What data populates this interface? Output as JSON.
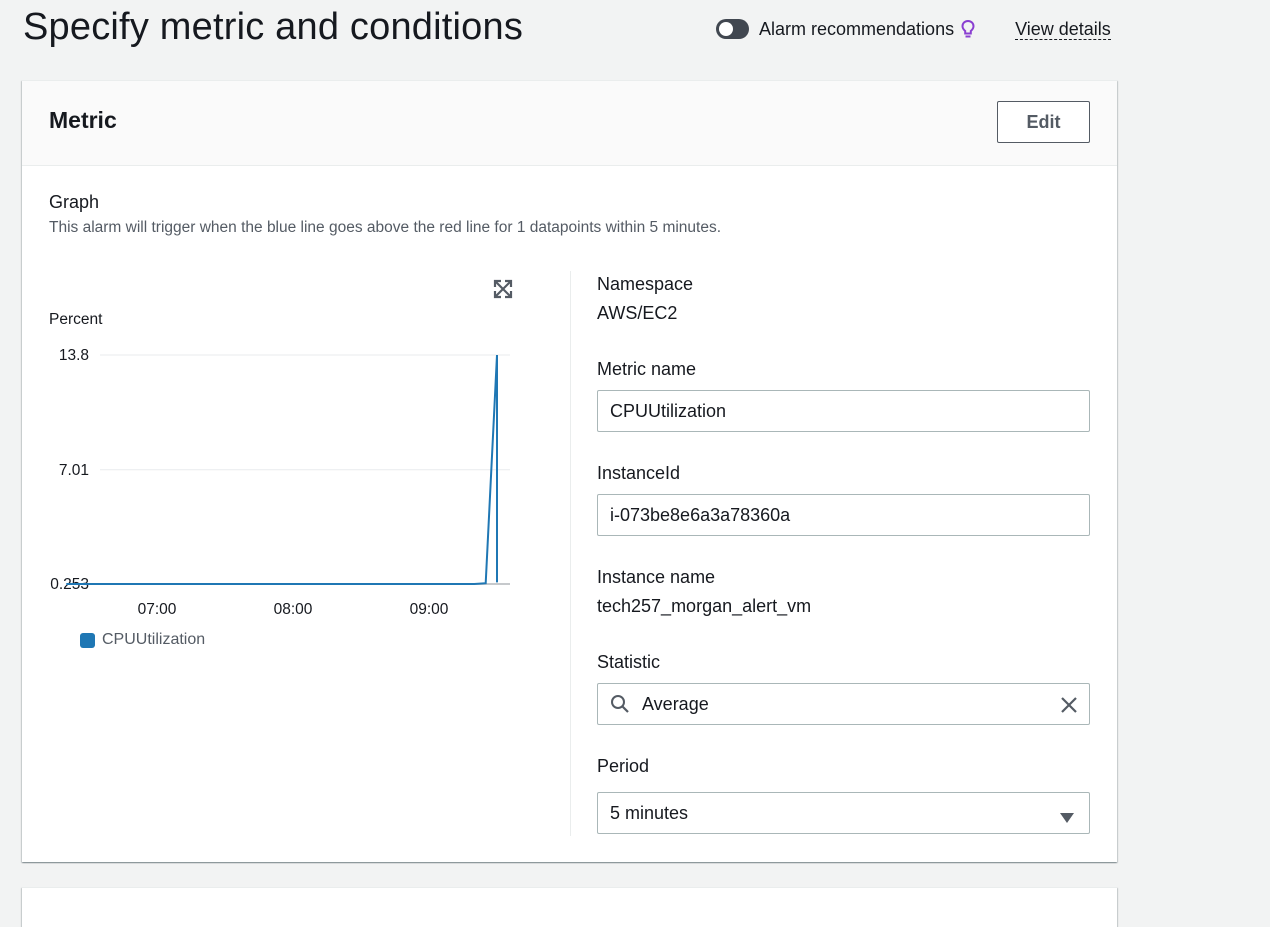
{
  "page": {
    "title": "Specify metric and conditions",
    "alarm_recommendations_label": "Alarm recommendations",
    "view_details_label": "View details"
  },
  "metric_panel": {
    "title": "Metric",
    "edit_label": "Edit",
    "graph_heading": "Graph",
    "graph_description": "This alarm will trigger when the blue line goes above the red line for 1 datapoints within 5 minutes.",
    "y_unit": "Percent"
  },
  "fields": {
    "namespace_label": "Namespace",
    "namespace_value": "AWS/EC2",
    "metric_name_label": "Metric name",
    "metric_name_value": "CPUUtilization",
    "instance_id_label": "InstanceId",
    "instance_id_value": "i-073be8e6a3a78360a",
    "instance_name_label": "Instance name",
    "instance_name_value": "tech257_morgan_alert_vm",
    "statistic_label": "Statistic",
    "statistic_value": "Average",
    "period_label": "Period",
    "period_value": "5 minutes"
  },
  "colors": {
    "series": "#1f77b4",
    "toggle_off": "#414750",
    "recommendation_icon": "#8a3fd1"
  },
  "chart_data": {
    "type": "line",
    "ylabel": "Percent",
    "yticks": [
      "13.8",
      "7.01",
      "0.253"
    ],
    "ylim": [
      0.253,
      13.8
    ],
    "xticks": [
      "07:00",
      "08:00",
      "09:00"
    ],
    "x_minutes": [
      "06:20",
      "06:25",
      "09:20",
      "09:25",
      "09:30",
      "09:35",
      "09:40",
      "09:45"
    ],
    "series": [
      {
        "name": "CPUUtilization",
        "values": [
          0.253,
          0.253,
          0.253,
          0.3,
          13.8,
          0.35,
          0.35,
          0.35
        ]
      }
    ]
  }
}
